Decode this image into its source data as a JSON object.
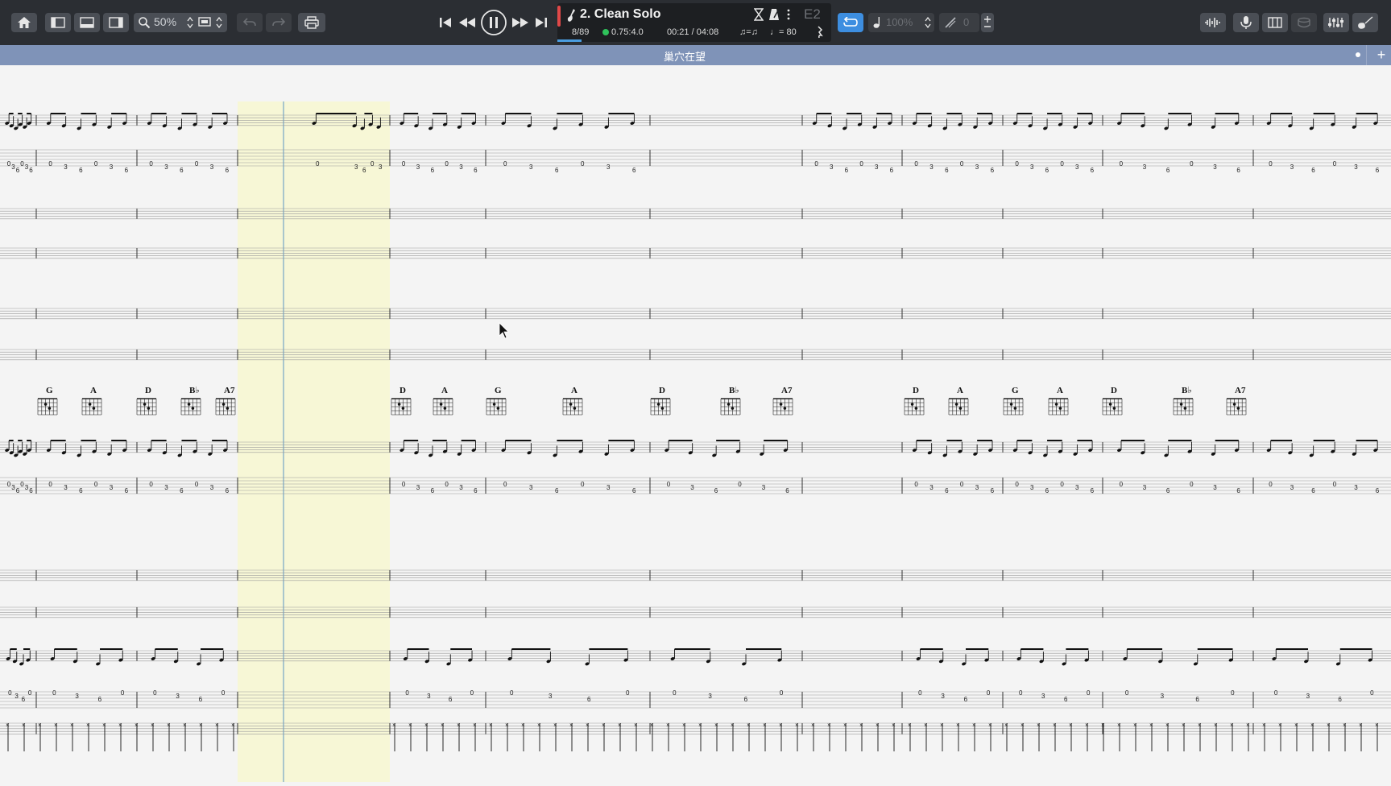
{
  "toolbar": {
    "zoom": "50%",
    "icons": [
      "home-icon",
      "layout-left-icon",
      "layout-bottom-icon",
      "layout-right-icon",
      "zoom-icon",
      "page-view-icon",
      "undo-icon",
      "redo-icon",
      "print-icon"
    ],
    "transport": [
      "skip-start-icon",
      "rewind-icon",
      "pause-icon",
      "fast-forward-icon",
      "skip-end-icon"
    ],
    "right_icons": [
      "waveform-icon",
      "microphone-icon",
      "panel-icon",
      "drum-icon",
      "mixer-icon",
      "guitar-icon"
    ]
  },
  "lcd": {
    "track": "2. Clean Solo",
    "bar": "8/89",
    "position": "0.75:4.0",
    "time": "00:21 / 04:08",
    "tempo": "= 80",
    "tuning": "E2"
  },
  "speed": {
    "value": "100%",
    "count": "0"
  },
  "score": {
    "title": "巢穴在望",
    "chords_row1": [
      "G",
      "A",
      "D",
      "B♭",
      "A7",
      "D",
      "A",
      "G",
      "A",
      "D",
      "B♭",
      "A7",
      "D",
      "A",
      "G",
      "A",
      "D",
      "B♭",
      "A7"
    ]
  },
  "colors": {
    "toolbar_bg": "#2b2e33",
    "title_bar": "#7f93b8",
    "selection": "#f7f7d6",
    "loop_accent": "#3d8ee0",
    "record_red": "#e04848"
  }
}
